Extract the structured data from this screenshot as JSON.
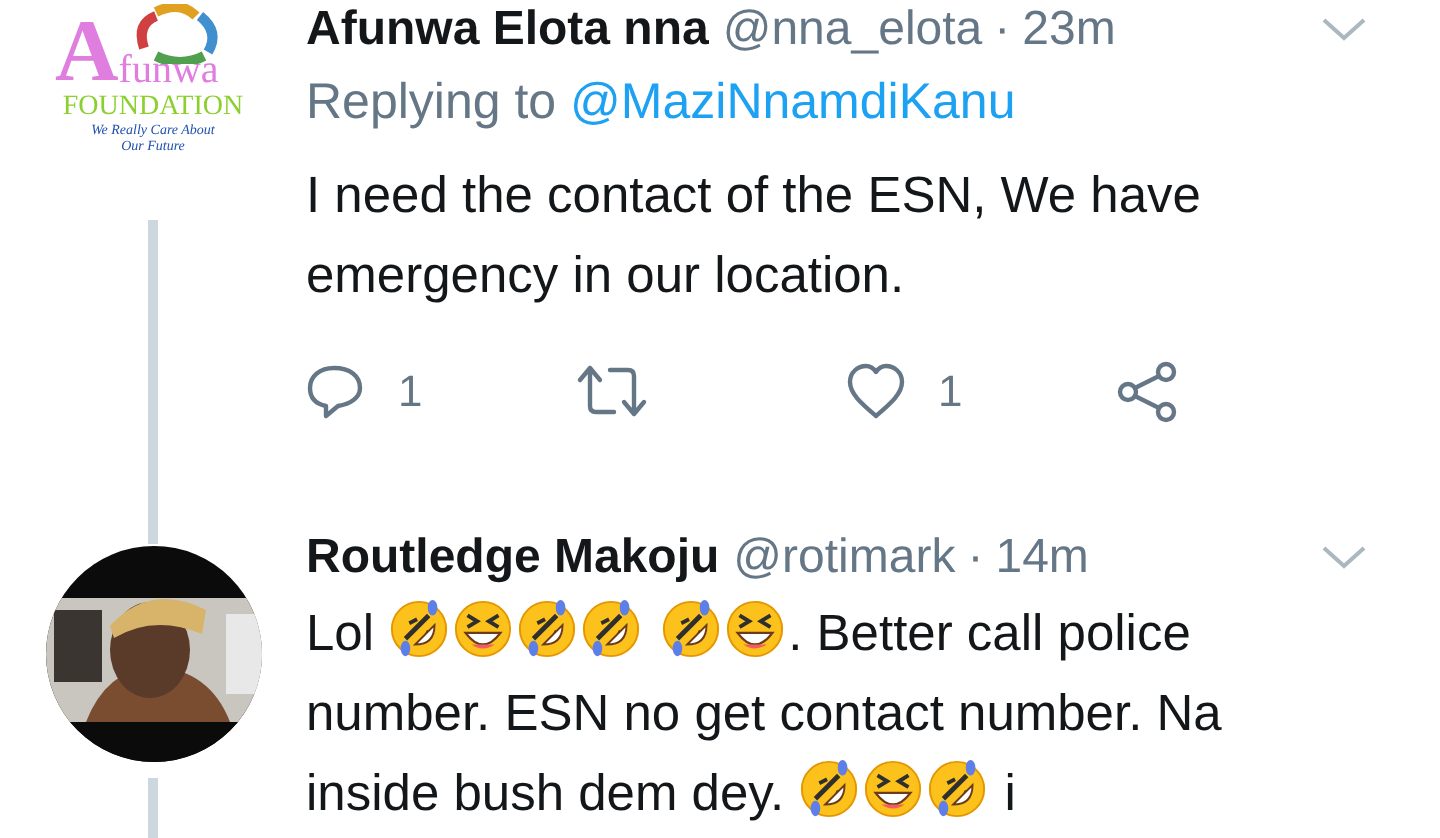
{
  "tweets": [
    {
      "avatar": {
        "kind": "logo",
        "letter": "A",
        "word": "funwa",
        "name": "FOUNDATION",
        "tagline": "We Really Care About Our Future"
      },
      "author": "Afunwa Elota nna",
      "handle": "@nna_elota",
      "separator": "·",
      "time": "23m",
      "reply_label": "Replying to",
      "reply_to": "@MaziNnamdiKanu",
      "body": [
        {
          "kind": "text",
          "text": "I need the contact of the ESN, We have emergency in our location."
        }
      ],
      "actions": [
        {
          "kind": "reply",
          "count": "1"
        },
        {
          "kind": "retweet"
        },
        {
          "kind": "like",
          "count": "1"
        },
        {
          "kind": "share"
        }
      ]
    },
    {
      "author": "Routledge Makoju",
      "handle": "@rotimark",
      "separator": "·",
      "time": "14m",
      "body": [
        {
          "kind": "text",
          "text": "Lol "
        },
        {
          "kind": "rofl"
        },
        {
          "kind": "grin"
        },
        {
          "kind": "rofl"
        },
        {
          "kind": "rofl"
        },
        {
          "kind": "gap"
        },
        {
          "kind": "rofl"
        },
        {
          "kind": "grin"
        },
        {
          "kind": "text",
          "text": ". Better call police number. ESN no get contact number. Na inside bush dem dey. "
        },
        {
          "kind": "rofl"
        },
        {
          "kind": "grin"
        },
        {
          "kind": "rofl"
        },
        {
          "kind": "text",
          "text": " i"
        }
      ]
    }
  ]
}
